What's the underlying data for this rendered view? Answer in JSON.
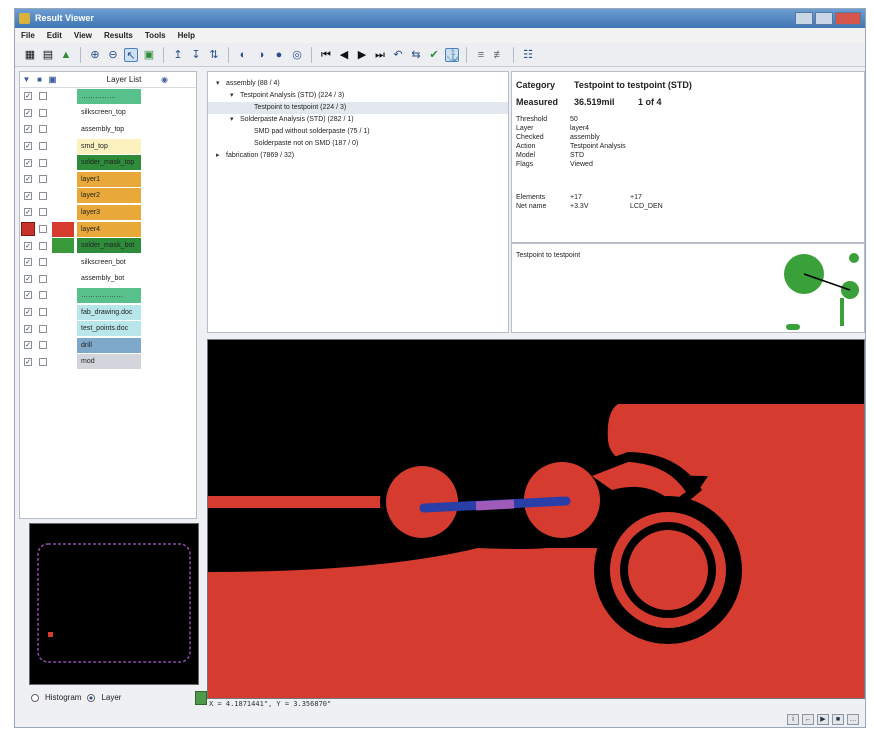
{
  "window": {
    "title": "Result Viewer"
  },
  "menu": [
    "File",
    "Edit",
    "View",
    "Results",
    "Tools",
    "Help"
  ],
  "toolbar": {
    "icons": [
      "grid-icon",
      "layers-icon",
      "palette-icon",
      "zoom-in-icon",
      "zoom-out-icon",
      "select-icon",
      "fit-icon",
      "up-icon",
      "down-icon",
      "swap-icon",
      "prev-layer-icon",
      "next-layer-icon",
      "layer-add-icon",
      "layer-remove-icon",
      "first-icon",
      "prev-icon",
      "next-icon",
      "last-icon",
      "undo-icon",
      "sync-icon",
      "check-icon",
      "anchor-icon",
      "filter-icon",
      "filter-off-icon",
      "report-icon"
    ]
  },
  "layers": {
    "header_title": "Layer List",
    "items": [
      {
        "name": "……………",
        "color": "#58c08a",
        "checked": true
      },
      {
        "name": "silkscreen_top",
        "color": "#ffffff",
        "checked": true
      },
      {
        "name": "assembly_top",
        "color": "#ffffff",
        "checked": true
      },
      {
        "name": "smd_top",
        "color": "#fbf2c0",
        "checked": true
      },
      {
        "name": "solder_mask_top",
        "color": "#2e8b3a",
        "checked": true
      },
      {
        "name": "layer1",
        "color": "#e8a93a",
        "checked": true
      },
      {
        "name": "layer2",
        "color": "#e8a93a",
        "checked": true
      },
      {
        "name": "layer3",
        "color": "#e8a93a",
        "checked": true
      },
      {
        "name": "layer4",
        "color": "#e8a93a",
        "checked": true,
        "selected": true,
        "swatch": "#d63b30"
      },
      {
        "name": "solder_mask_bot",
        "color": "#2e8b3a",
        "checked": true,
        "swatch": "#3a9a3a"
      },
      {
        "name": "silkscreen_bot",
        "color": "#ffffff",
        "checked": true
      },
      {
        "name": "assembly_bot",
        "color": "#ffffff",
        "checked": true
      },
      {
        "name": "………………",
        "color": "#58c08a",
        "checked": true
      },
      {
        "name": "fab_drawing.doc",
        "color": "#b9e6ea",
        "checked": true
      },
      {
        "name": "test_points.doc",
        "color": "#b9e6ea",
        "checked": true
      },
      {
        "name": "drill",
        "color": "#7ea8c9",
        "checked": true
      },
      {
        "name": "mod",
        "color": "#d2d6dc",
        "checked": true
      }
    ]
  },
  "view_mode": {
    "histogram_label": "Histogram",
    "layer_label": "Layer",
    "selected": "Layer"
  },
  "tree": [
    {
      "text": "assembly (88 / 4)",
      "depth": 0,
      "toggle": "▾"
    },
    {
      "text": "Testpoint Analysis (STD) (224 / 3)",
      "depth": 1,
      "toggle": "▾"
    },
    {
      "text": "Testpoint to testpoint (224 / 3)",
      "depth": 2,
      "toggle": "",
      "selected": true
    },
    {
      "text": "Solderpaste Analysis (STD) (282 / 1)",
      "depth": 1,
      "toggle": "▾"
    },
    {
      "text": "SMD pad without solderpaste (75 / 1)",
      "depth": 2,
      "toggle": ""
    },
    {
      "text": "Solderpaste not on SMD (187 / 0)",
      "depth": 2,
      "toggle": ""
    },
    {
      "text": "fabrication (7869 / 32)",
      "depth": 0,
      "toggle": "▸"
    }
  ],
  "details": {
    "category_label": "Category",
    "category_value": "Testpoint to testpoint (STD)",
    "measured_label": "Measured",
    "measured_value": "36.519mil",
    "measured_index": "1 of 4",
    "props": [
      {
        "k": "Threshold",
        "v": "50"
      },
      {
        "k": "Layer",
        "v": "layer4"
      },
      {
        "k": "Checked",
        "v": "assembly"
      },
      {
        "k": "Action",
        "v": "Testpoint Analysis"
      },
      {
        "k": "Model",
        "v": "STD"
      },
      {
        "k": "Flags",
        "v": "Viewed"
      }
    ],
    "element_label": "Elements",
    "element_values": [
      "+17",
      "+17"
    ],
    "net_label": "Net name",
    "net_values": [
      "+3.3V",
      "LCD_DEN"
    ]
  },
  "description": {
    "text": "Testpoint to testpoint"
  },
  "status": {
    "coords": "X = 4.1871441\", Y = 3.356870\""
  },
  "colors": {
    "copper": "#d63b30",
    "board": "#000000",
    "measure": "#2a3ea8",
    "measure_mid": "#a05ab8"
  }
}
